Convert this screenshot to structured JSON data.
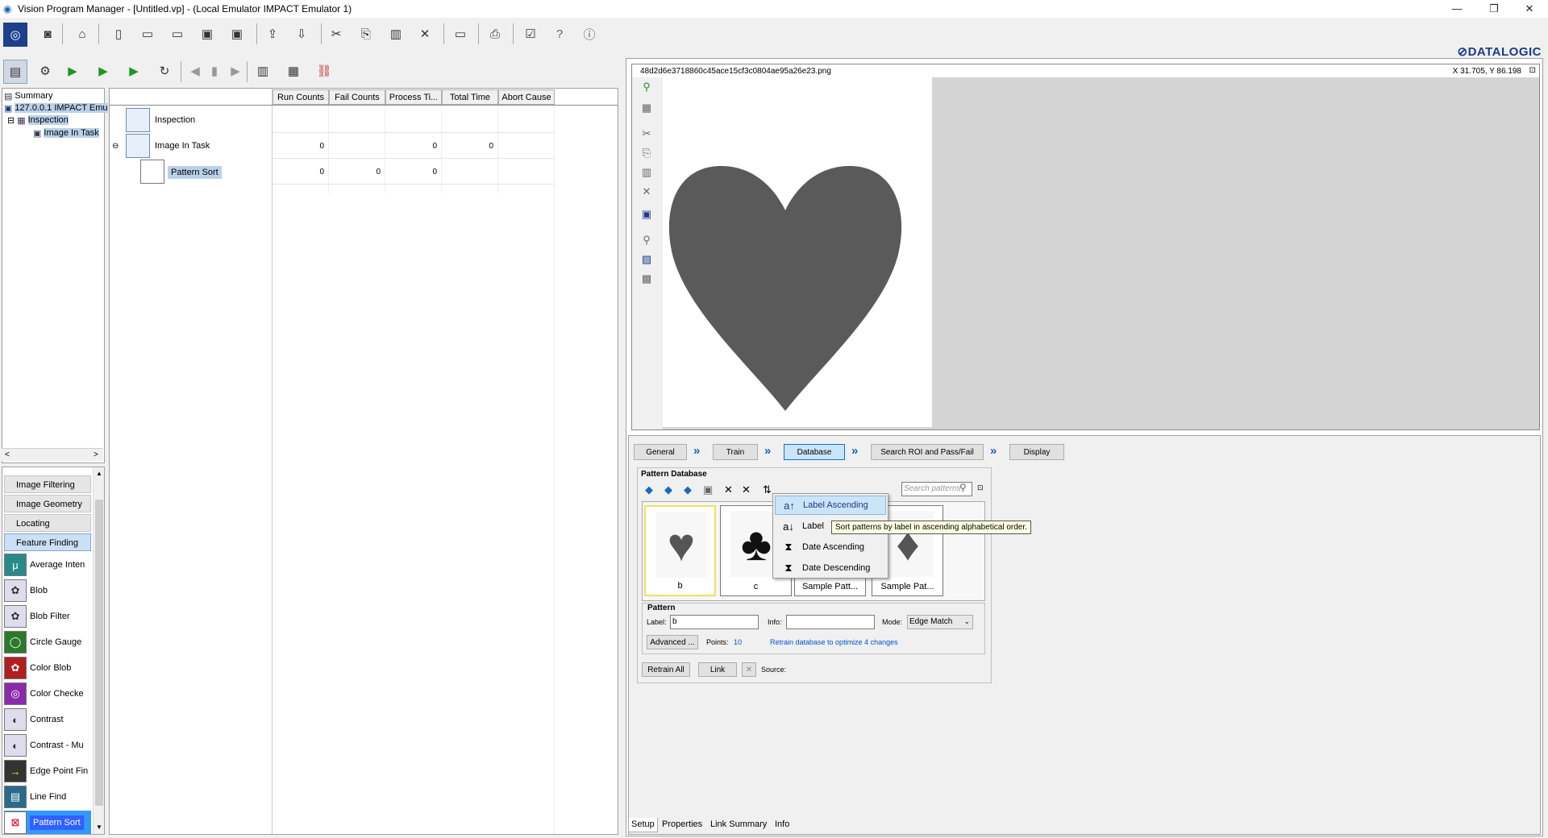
{
  "window": {
    "title": "Vision Program Manager - [Untitled.vp] - (Local Emulator IMPACT Emulator 1)",
    "minimize": "—",
    "restore": "❐",
    "close": "✕"
  },
  "brand": {
    "logo": "⊘DATALOGIC"
  },
  "tree": {
    "summary": "Summary",
    "device": "127.0.0.1 IMPACT Emu",
    "inspection": "Inspection",
    "image_in_task": "Image In Task",
    "hscroll_left": "<",
    "hscroll_right": ">"
  },
  "tools": {
    "categories": [
      "Image Filtering",
      "Image Geometry",
      "Locating",
      "Feature Finding"
    ],
    "items": [
      "Average Inten",
      "Blob",
      "Blob Filter",
      "Circle Gauge",
      "Color Blob",
      "Color Checke",
      "Contrast",
      "Contrast - Mu",
      "Edge Point Fin",
      "Line Find",
      "Pattern Sort"
    ]
  },
  "grid": {
    "columns": [
      "Run Counts",
      "Fail Counts",
      "Process Ti...",
      "Total Time",
      "Abort Cause"
    ],
    "rows": [
      {
        "name": "Inspection",
        "values": [
          "",
          "",
          "",
          "",
          ""
        ]
      },
      {
        "name": "Image In Task",
        "values": [
          "0",
          "",
          "0",
          "0",
          ""
        ]
      },
      {
        "name": "Pattern Sort",
        "values": [
          "0",
          "0",
          "0",
          "",
          ""
        ]
      }
    ]
  },
  "view": {
    "filename": "48d2d6e3718860c45ace15cf3c0804ae95a26e23.png",
    "coords": "X 31.705,  Y 86.198"
  },
  "steps": {
    "tabs": [
      "General",
      "Train",
      "Database",
      "Search ROI and Pass/Fail",
      "Display"
    ],
    "active": "Database"
  },
  "database": {
    "title": "Pattern Database",
    "search_placeholder": "Search patterns",
    "patterns": [
      {
        "label": "b",
        "glyph": "♥"
      },
      {
        "label": "c",
        "glyph": "♣"
      },
      {
        "label": "Sample Patt...",
        "glyph": ""
      },
      {
        "label": "Sample Pat...",
        "glyph": "♦"
      }
    ]
  },
  "pattern": {
    "title": "Pattern",
    "label_caption": "Label:",
    "label_value": "b",
    "info_caption": "Info:",
    "info_value": "",
    "mode_caption": "Mode:",
    "mode_value": "Edge Match",
    "advanced": "Advanced ...",
    "points_caption": "Points:",
    "points_value": "10",
    "retrain_link": "Retrain database to optimize 4 changes"
  },
  "footer_buttons": {
    "retrain_all": "Retrain All",
    "link": "Link",
    "source": "Source:"
  },
  "context_menu": {
    "items": [
      "Label Ascending",
      "Label",
      "Date Ascending",
      "Date Descending"
    ]
  },
  "tooltip": "Sort patterns by label in ascending alphabetical order.",
  "bottom_tabs": [
    "Setup",
    "Properties",
    "Link Summary",
    "Info"
  ],
  "colors": {
    "accent": "#3399ff",
    "heart": "#5a5a5a",
    "link": "#0055cc"
  }
}
